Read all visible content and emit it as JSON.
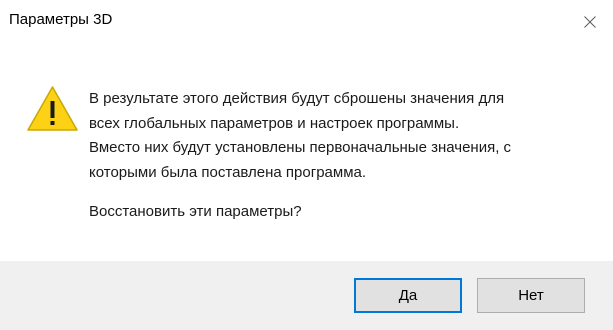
{
  "window": {
    "title": "Параметры 3D",
    "close_icon": "close-icon"
  },
  "message": {
    "icon": "warning-icon",
    "lines": [
      "В результате этого действия будут сброшены значения для",
      "всех глобальных параметров и настроек программы.",
      "Вместо них будут установлены первоначальные значения, с",
      "которыми была поставлена программа."
    ],
    "question": "Восстановить эти параметры?"
  },
  "buttons": {
    "yes_label": "Да",
    "no_label": "Нет",
    "default": "yes"
  },
  "colors": {
    "warning_fill": "#fcd116",
    "footer_bg": "#f0f0f0",
    "default_border": "#0078d7"
  }
}
